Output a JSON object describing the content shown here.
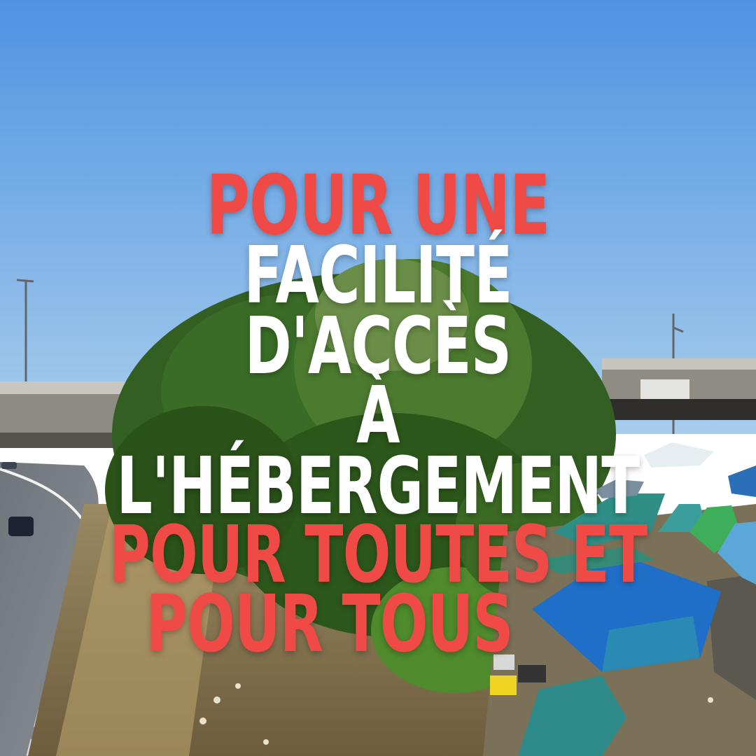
{
  "headline": {
    "line1": "POUR UNE",
    "line2": "FACILITÉ D'ACCÈS",
    "line3": "À L'HÉBERGEMENT",
    "line4": "POUR TOUTES ET",
    "line5": "POUR TOUS"
  },
  "colors": {
    "accent_red": "#f04a47",
    "text_white": "#ffffff",
    "sky": "#5f9fe0"
  }
}
